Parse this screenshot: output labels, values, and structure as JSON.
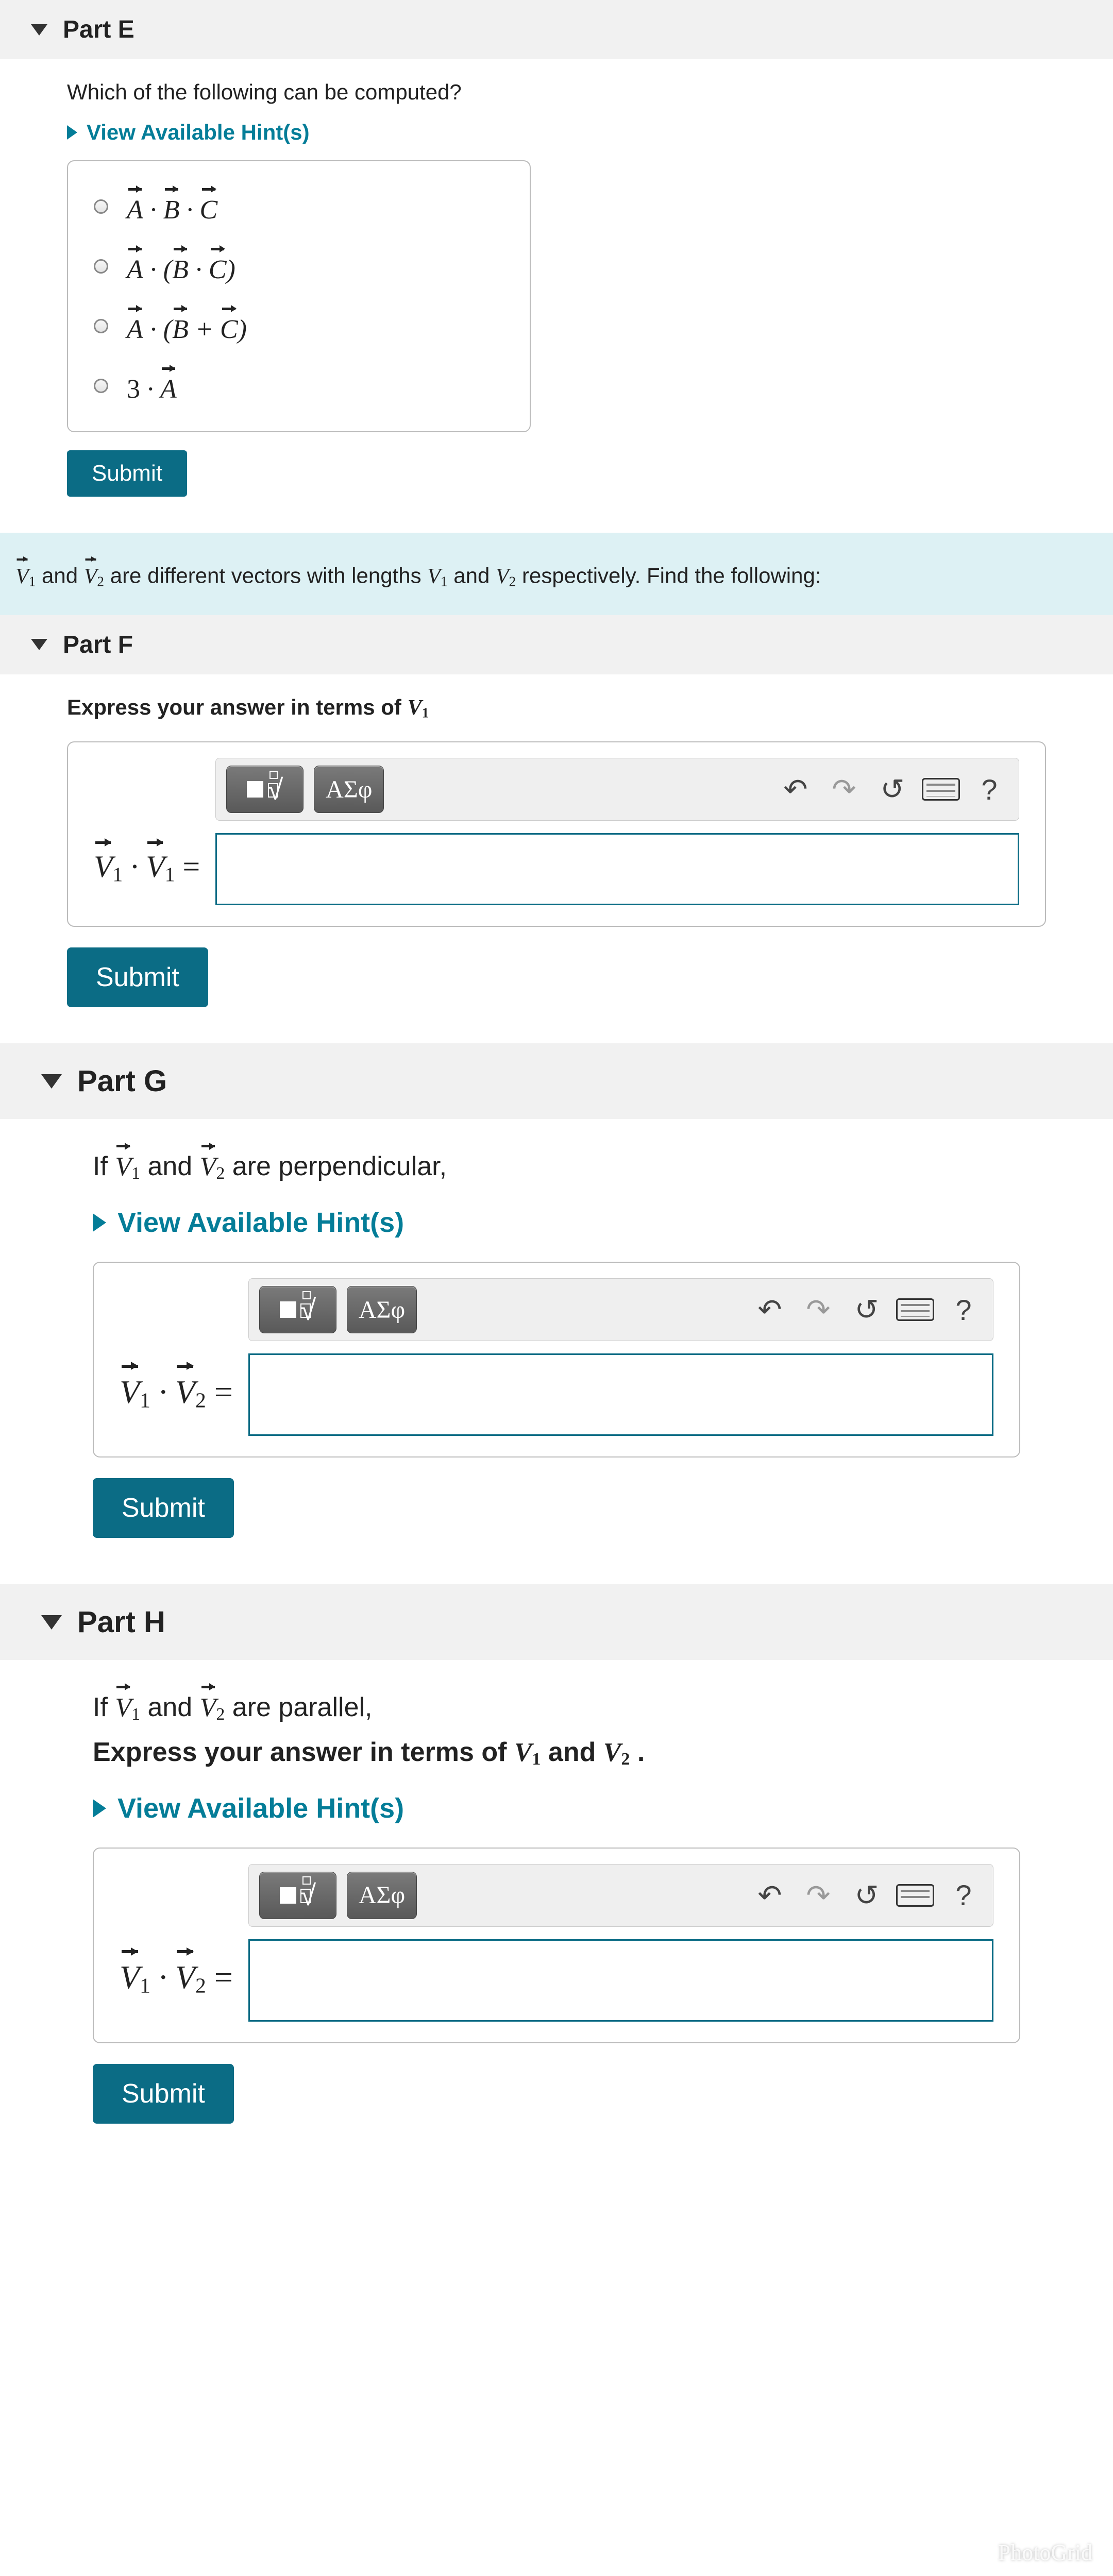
{
  "partE": {
    "title": "Part E",
    "question": "Which of the following can be computed?",
    "hints": "View Available Hint(s)",
    "options": {
      "a": "A⃗ · B⃗ · C⃗",
      "b": "A⃗ · (B⃗ · C⃗)",
      "c": "A⃗ · (B⃗ + C⃗)",
      "d": "3 · A⃗"
    },
    "submit": "Submit"
  },
  "info": {
    "pre": "V⃗₁ and V⃗₂ are different vectors with lengths ",
    "v1": "V₁",
    "mid": " and ",
    "v2": "V₂",
    "post": " respectively. Find the following:"
  },
  "partF": {
    "title": "Part F",
    "prompt_pre": "Express your answer in terms of ",
    "prompt_var": "V₁",
    "lhs": "V⃗₁ · V⃗₁ =",
    "submit": "Submit"
  },
  "partG": {
    "title": "Part G",
    "prompt": "If V⃗₁ and V⃗₂ are perpendicular,",
    "hints": "View Available Hint(s)",
    "lhs": "V⃗₁ · V⃗₂ =",
    "submit": "Submit"
  },
  "partH": {
    "title": "Part H",
    "prompt1": "If V⃗₁ and V⃗₂ are parallel,",
    "prompt2_pre": "Express your answer in terms of ",
    "prompt2_v1": "V₁",
    "prompt2_mid": " and ",
    "prompt2_v2": "V₂",
    "prompt2_post": " .",
    "hints": "View Available Hint(s)",
    "lhs": "V⃗₁ · V⃗₂ =",
    "submit": "Submit"
  },
  "toolbar": {
    "greek": "ΑΣφ",
    "help": "?"
  },
  "watermark": "PhotoGrid"
}
